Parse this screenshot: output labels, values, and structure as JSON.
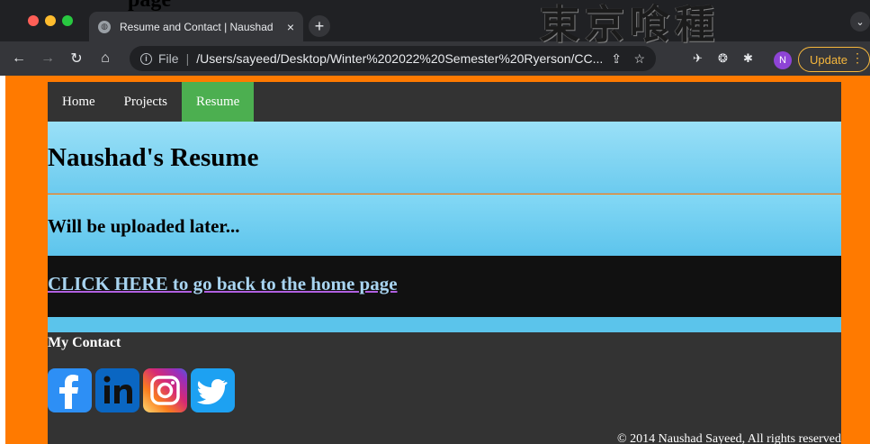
{
  "browser": {
    "tab_title": "Resume and Contact | Naushad",
    "tab_close": "×",
    "new_tab": "+",
    "tab_menu": "⌄",
    "scheme": "File",
    "url": "/Users/sayeed/Desktop/Winter%202022%20Semester%20Ryerson/CC...",
    "profile_initial": "N",
    "update_label": "Update"
  },
  "stray": {
    "title_fragment": "page",
    "logo_text": "東京喰種"
  },
  "nav": {
    "items": [
      "Home",
      "Projects",
      "Resume"
    ],
    "active": "Resume"
  },
  "header": {
    "title": "Naushad's Resume"
  },
  "notice": {
    "text": "Will be uploaded later..."
  },
  "home_link": {
    "text": "CLICK HERE to go back to the home page"
  },
  "footer": {
    "contact_title": "My Contact",
    "socials": [
      "facebook",
      "linkedin",
      "instagram",
      "twitter"
    ],
    "copyright": "© 2014 Naushad Sayeed, All rights reserved"
  },
  "colors": {
    "page_bg": "#ff7a00",
    "nav_bg": "#333333",
    "nav_active": "#4caf50",
    "band": "#6ccbef",
    "link_band": "#111111"
  }
}
